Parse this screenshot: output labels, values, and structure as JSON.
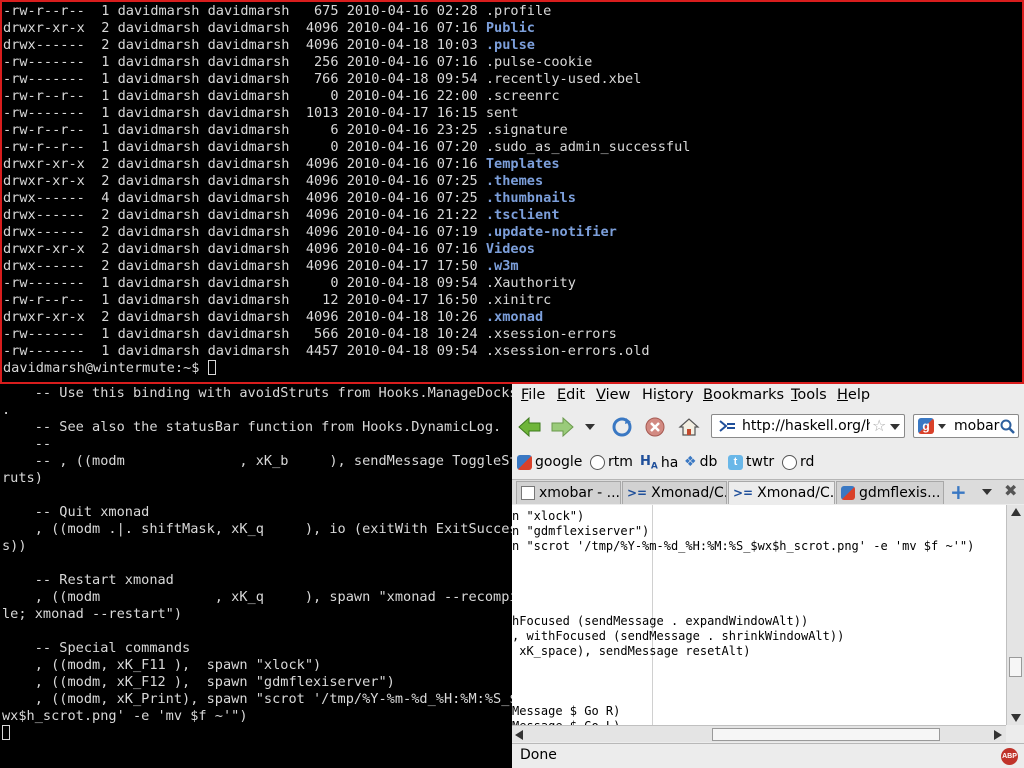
{
  "term_top": {
    "listing": [
      {
        "perms": "-rw-r--r--",
        "links": "1",
        "owner": "davidmarsh",
        "group": "davidmarsh",
        "size": "675",
        "date": "2010-04-16",
        "time": "02:28",
        "name": ".profile",
        "dir": false
      },
      {
        "perms": "drwxr-xr-x",
        "links": "2",
        "owner": "davidmarsh",
        "group": "davidmarsh",
        "size": "4096",
        "date": "2010-04-16",
        "time": "07:16",
        "name": "Public",
        "dir": true
      },
      {
        "perms": "drwx------",
        "links": "2",
        "owner": "davidmarsh",
        "group": "davidmarsh",
        "size": "4096",
        "date": "2010-04-18",
        "time": "10:03",
        "name": ".pulse",
        "dir": true
      },
      {
        "perms": "-rw-------",
        "links": "1",
        "owner": "davidmarsh",
        "group": "davidmarsh",
        "size": "256",
        "date": "2010-04-16",
        "time": "07:16",
        "name": ".pulse-cookie",
        "dir": false
      },
      {
        "perms": "-rw-------",
        "links": "1",
        "owner": "davidmarsh",
        "group": "davidmarsh",
        "size": "766",
        "date": "2010-04-18",
        "time": "09:54",
        "name": ".recently-used.xbel",
        "dir": false
      },
      {
        "perms": "-rw-r--r--",
        "links": "1",
        "owner": "davidmarsh",
        "group": "davidmarsh",
        "size": "0",
        "date": "2010-04-16",
        "time": "22:00",
        "name": ".screenrc",
        "dir": false
      },
      {
        "perms": "-rw-------",
        "links": "1",
        "owner": "davidmarsh",
        "group": "davidmarsh",
        "size": "1013",
        "date": "2010-04-17",
        "time": "16:15",
        "name": "sent",
        "dir": false
      },
      {
        "perms": "-rw-r--r--",
        "links": "1",
        "owner": "davidmarsh",
        "group": "davidmarsh",
        "size": "6",
        "date": "2010-04-16",
        "time": "23:25",
        "name": ".signature",
        "dir": false
      },
      {
        "perms": "-rw-r--r--",
        "links": "1",
        "owner": "davidmarsh",
        "group": "davidmarsh",
        "size": "0",
        "date": "2010-04-16",
        "time": "07:20",
        "name": ".sudo_as_admin_successful",
        "dir": false
      },
      {
        "perms": "drwxr-xr-x",
        "links": "2",
        "owner": "davidmarsh",
        "group": "davidmarsh",
        "size": "4096",
        "date": "2010-04-16",
        "time": "07:16",
        "name": "Templates",
        "dir": true
      },
      {
        "perms": "drwxr-xr-x",
        "links": "2",
        "owner": "davidmarsh",
        "group": "davidmarsh",
        "size": "4096",
        "date": "2010-04-16",
        "time": "07:25",
        "name": ".themes",
        "dir": true
      },
      {
        "perms": "drwx------",
        "links": "4",
        "owner": "davidmarsh",
        "group": "davidmarsh",
        "size": "4096",
        "date": "2010-04-16",
        "time": "07:25",
        "name": ".thumbnails",
        "dir": true
      },
      {
        "perms": "drwx------",
        "links": "2",
        "owner": "davidmarsh",
        "group": "davidmarsh",
        "size": "4096",
        "date": "2010-04-16",
        "time": "21:22",
        "name": ".tsclient",
        "dir": true
      },
      {
        "perms": "drwx------",
        "links": "2",
        "owner": "davidmarsh",
        "group": "davidmarsh",
        "size": "4096",
        "date": "2010-04-16",
        "time": "07:19",
        "name": ".update-notifier",
        "dir": true
      },
      {
        "perms": "drwxr-xr-x",
        "links": "2",
        "owner": "davidmarsh",
        "group": "davidmarsh",
        "size": "4096",
        "date": "2010-04-16",
        "time": "07:16",
        "name": "Videos",
        "dir": true
      },
      {
        "perms": "drwx------",
        "links": "2",
        "owner": "davidmarsh",
        "group": "davidmarsh",
        "size": "4096",
        "date": "2010-04-17",
        "time": "17:50",
        "name": ".w3m",
        "dir": true
      },
      {
        "perms": "-rw-------",
        "links": "1",
        "owner": "davidmarsh",
        "group": "davidmarsh",
        "size": "0",
        "date": "2010-04-18",
        "time": "09:54",
        "name": ".Xauthority",
        "dir": false
      },
      {
        "perms": "-rw-r--r--",
        "links": "1",
        "owner": "davidmarsh",
        "group": "davidmarsh",
        "size": "12",
        "date": "2010-04-17",
        "time": "16:50",
        "name": ".xinitrc",
        "dir": false
      },
      {
        "perms": "drwxr-xr-x",
        "links": "2",
        "owner": "davidmarsh",
        "group": "davidmarsh",
        "size": "4096",
        "date": "2010-04-18",
        "time": "10:26",
        "name": ".xmonad",
        "dir": true
      },
      {
        "perms": "-rw-------",
        "links": "1",
        "owner": "davidmarsh",
        "group": "davidmarsh",
        "size": "566",
        "date": "2010-04-18",
        "time": "10:24",
        "name": ".xsession-errors",
        "dir": false
      },
      {
        "perms": "-rw-------",
        "links": "1",
        "owner": "davidmarsh",
        "group": "davidmarsh",
        "size": "4457",
        "date": "2010-04-18",
        "time": "09:54",
        "name": ".xsession-errors.old",
        "dir": false
      }
    ],
    "prompt": "davidmarsh@wintermute:~$ "
  },
  "term_bottom_left": {
    "lines": [
      "    -- Use this binding with avoidStruts from Hooks.ManageDocks",
      ".",
      "    -- See also the statusBar function from Hooks.DynamicLog.",
      "    --",
      "    -- , ((modm              , xK_b     ), sendMessage ToggleSt",
      "ruts)",
      "",
      "    -- Quit xmonad",
      "    , ((modm .|. shiftMask, xK_q     ), io (exitWith ExitSucces",
      "s))",
      "",
      "    -- Restart xmonad",
      "    , ((modm              , xK_q     ), spawn \"xmonad --recompi",
      "le; xmonad --restart\")",
      "",
      "    -- Special commands",
      "    , ((modm, xK_F11 ),  spawn \"xlock\")",
      "    , ((modm, xK_F12 ),  spawn \"gdmflexiserver\")",
      "    , ((modm, xK_Print), spawn \"scrot '/tmp/%Y-%m-%d_%H:%M:%S_$",
      "wx$h_scrot.png' -e 'mv $f ~'\")"
    ]
  },
  "browser": {
    "menu": [
      "File",
      "Edit",
      "View",
      "History",
      "Bookmarks",
      "Tools",
      "Help"
    ],
    "url": "http://haskell.org/haskellwiki/Xmonad",
    "search": "mobar",
    "bookmarks": [
      "google",
      "rtm",
      "ha",
      "db",
      "twtr",
      "rd"
    ],
    "tabs": [
      "xmobar - ...",
      "Xmonad/C...",
      "Xmonad/C...",
      "gdmflexis..."
    ],
    "content_lines": [
      "n \"xlock\")",
      "n \"gdmflexiserver\")",
      "n \"scrot '/tmp/%Y-%m-%d_%H:%M:%S_$wx$h_scrot.png' -e 'mv $f ~'\")",
      "",
      "",
      "",
      "",
      "hFocused (sendMessage . expandWindowAlt))",
      ", withFocused (sendMessage . shrinkWindowAlt))",
      " xK_space), sendMessage resetAlt)",
      "",
      "",
      "",
      "Message $ Go R)",
      "Message $ Go L)"
    ],
    "status": "Done"
  },
  "colors": {
    "terminal_bg": "#000000",
    "terminal_fg": "#d9d9d9",
    "dir_color": "#7c9fdb",
    "focus_border": "#d81d1d"
  }
}
